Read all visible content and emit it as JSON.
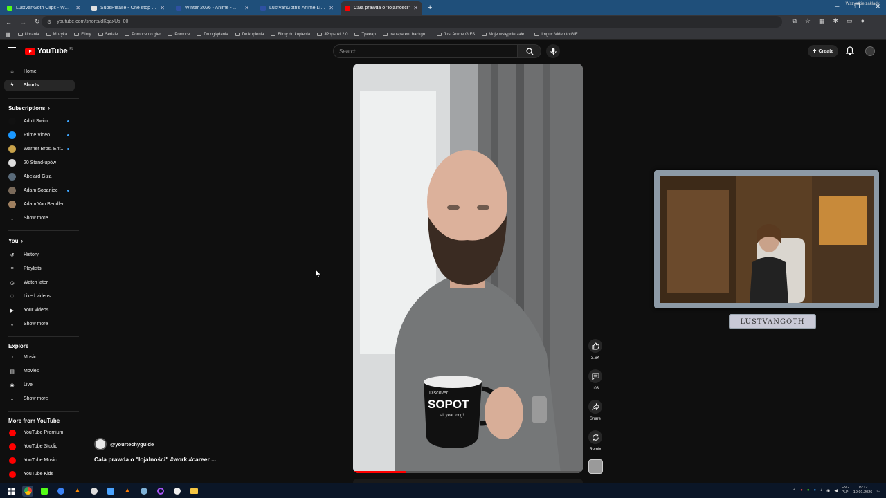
{
  "browser": {
    "tabs": [
      {
        "title": "LustVanGoth Clips - Watch Liv",
        "color": "#53fc18",
        "active": false
      },
      {
        "title": "SubsPlease - One stop shop fo",
        "color": "#e0e0e0",
        "active": false
      },
      {
        "title": "Winter 2026 - Anime - MyAnim",
        "color": "#2e51a2",
        "active": false
      },
      {
        "title": "LustVanGoth's Anime List - My",
        "color": "#2e51a2",
        "active": false
      },
      {
        "title": "Cała prawda o \"lojalności\"",
        "color": "#ff0000",
        "active": true
      }
    ],
    "url": "youtube.com/shorts/dKqaxUs_00",
    "bookmarks": [
      "Ubrania",
      "Muzyka",
      "Filmy",
      "Seriale",
      "Pomoce do gier",
      "Pomoce",
      "Do oglądania",
      "Do kupienia",
      "Filmy do kupienia",
      "JPopsuki 2.0",
      "Tpeeap",
      "transparent backgro...",
      "Just Anime GIFS",
      "Moje wstępnie załe...",
      "Imgur: Video to GIF"
    ],
    "bookmarks_right": "Wszystkie zakładki"
  },
  "youtube": {
    "logo_text": "YouTube",
    "logo_region": "PL",
    "search_placeholder": "Search",
    "create_label": "Create",
    "sidebar": {
      "main": [
        {
          "label": "Home",
          "icon": "home-icon",
          "active": false
        },
        {
          "label": "Shorts",
          "icon": "shorts-icon",
          "active": true
        }
      ],
      "subscriptions_title": "Subscriptions",
      "subscriptions": [
        {
          "label": "Adult Swim",
          "avatar_color": "#111111",
          "live": true
        },
        {
          "label": "Prime Video",
          "avatar_color": "#1a98ff",
          "live": true
        },
        {
          "label": "Warner Bros. Ent...",
          "avatar_color": "#c8a24a",
          "live": true
        },
        {
          "label": "20 Stand-upów",
          "avatar_color": "#dddddd",
          "live": false
        },
        {
          "label": "Abelard Giza",
          "avatar_color": "#5a6b7a",
          "live": false
        },
        {
          "label": "Adam Sobaniec",
          "avatar_color": "#7a6a5a",
          "live": true
        },
        {
          "label": "Adam Van Bendler ...",
          "avatar_color": "#a08060",
          "live": false
        }
      ],
      "show_more_1": "Show more",
      "you_title": "You",
      "you": [
        {
          "label": "History",
          "icon": "history-icon"
        },
        {
          "label": "Playlists",
          "icon": "playlists-icon"
        },
        {
          "label": "Watch later",
          "icon": "watch-later-icon"
        },
        {
          "label": "Liked videos",
          "icon": "liked-videos-icon"
        },
        {
          "label": "Your videos",
          "icon": "your-videos-icon"
        }
      ],
      "show_more_2": "Show more",
      "explore_title": "Explore",
      "explore": [
        {
          "label": "Music",
          "icon": "music-icon"
        },
        {
          "label": "Movies",
          "icon": "movies-icon"
        },
        {
          "label": "Live",
          "icon": "live-icon"
        }
      ],
      "show_more_3": "Show more",
      "more_title": "More from YouTube",
      "more": [
        {
          "label": "YouTube Premium"
        },
        {
          "label": "YouTube Studio"
        },
        {
          "label": "YouTube Music"
        },
        {
          "label": "YouTube Kids"
        }
      ]
    },
    "short": {
      "channel": "@yourtechyguide",
      "title": "Cała prawda o \"lojalności\" #work #career ...",
      "mug_line1": "Discover",
      "mug_line2": "SOPOT",
      "mug_line3": "all year long!",
      "progress": 0.23,
      "actions": {
        "likes": "3.6K",
        "comments": "103",
        "share": "Share",
        "remix": "Remix"
      }
    }
  },
  "overlay": {
    "name": "LUSTVANGOTH"
  },
  "taskbar": {
    "lang1": "ENG",
    "lang2": "PLP",
    "time": "19:12",
    "date": "19.01.2026"
  }
}
